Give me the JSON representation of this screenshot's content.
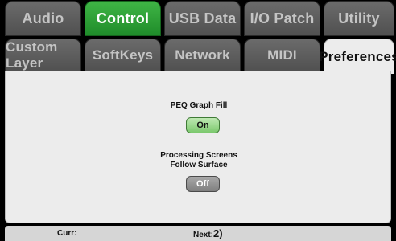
{
  "tabs_row1": [
    "Audio",
    "Control",
    "USB Data",
    "I/O Patch",
    "Utility"
  ],
  "tabs_row2": [
    "Custom Layer",
    "SoftKeys",
    "Network",
    "MIDI",
    "Preferences"
  ],
  "active_section": "Control",
  "active_page": "Preferences",
  "settings": {
    "peq_graph_fill": {
      "label": "PEQ Graph Fill",
      "value": "On"
    },
    "processing_follow": {
      "label_line1": "Processing Screens",
      "label_line2": "Follow Surface",
      "value": "Off"
    }
  },
  "status": {
    "curr_label": "Curr:",
    "next_label": "Next:",
    "next_value": "2)"
  },
  "colors": {
    "active_tab": "#2ea537",
    "panel": "#ececec",
    "on_button": "#9ad88c",
    "off_button": "#909090"
  }
}
